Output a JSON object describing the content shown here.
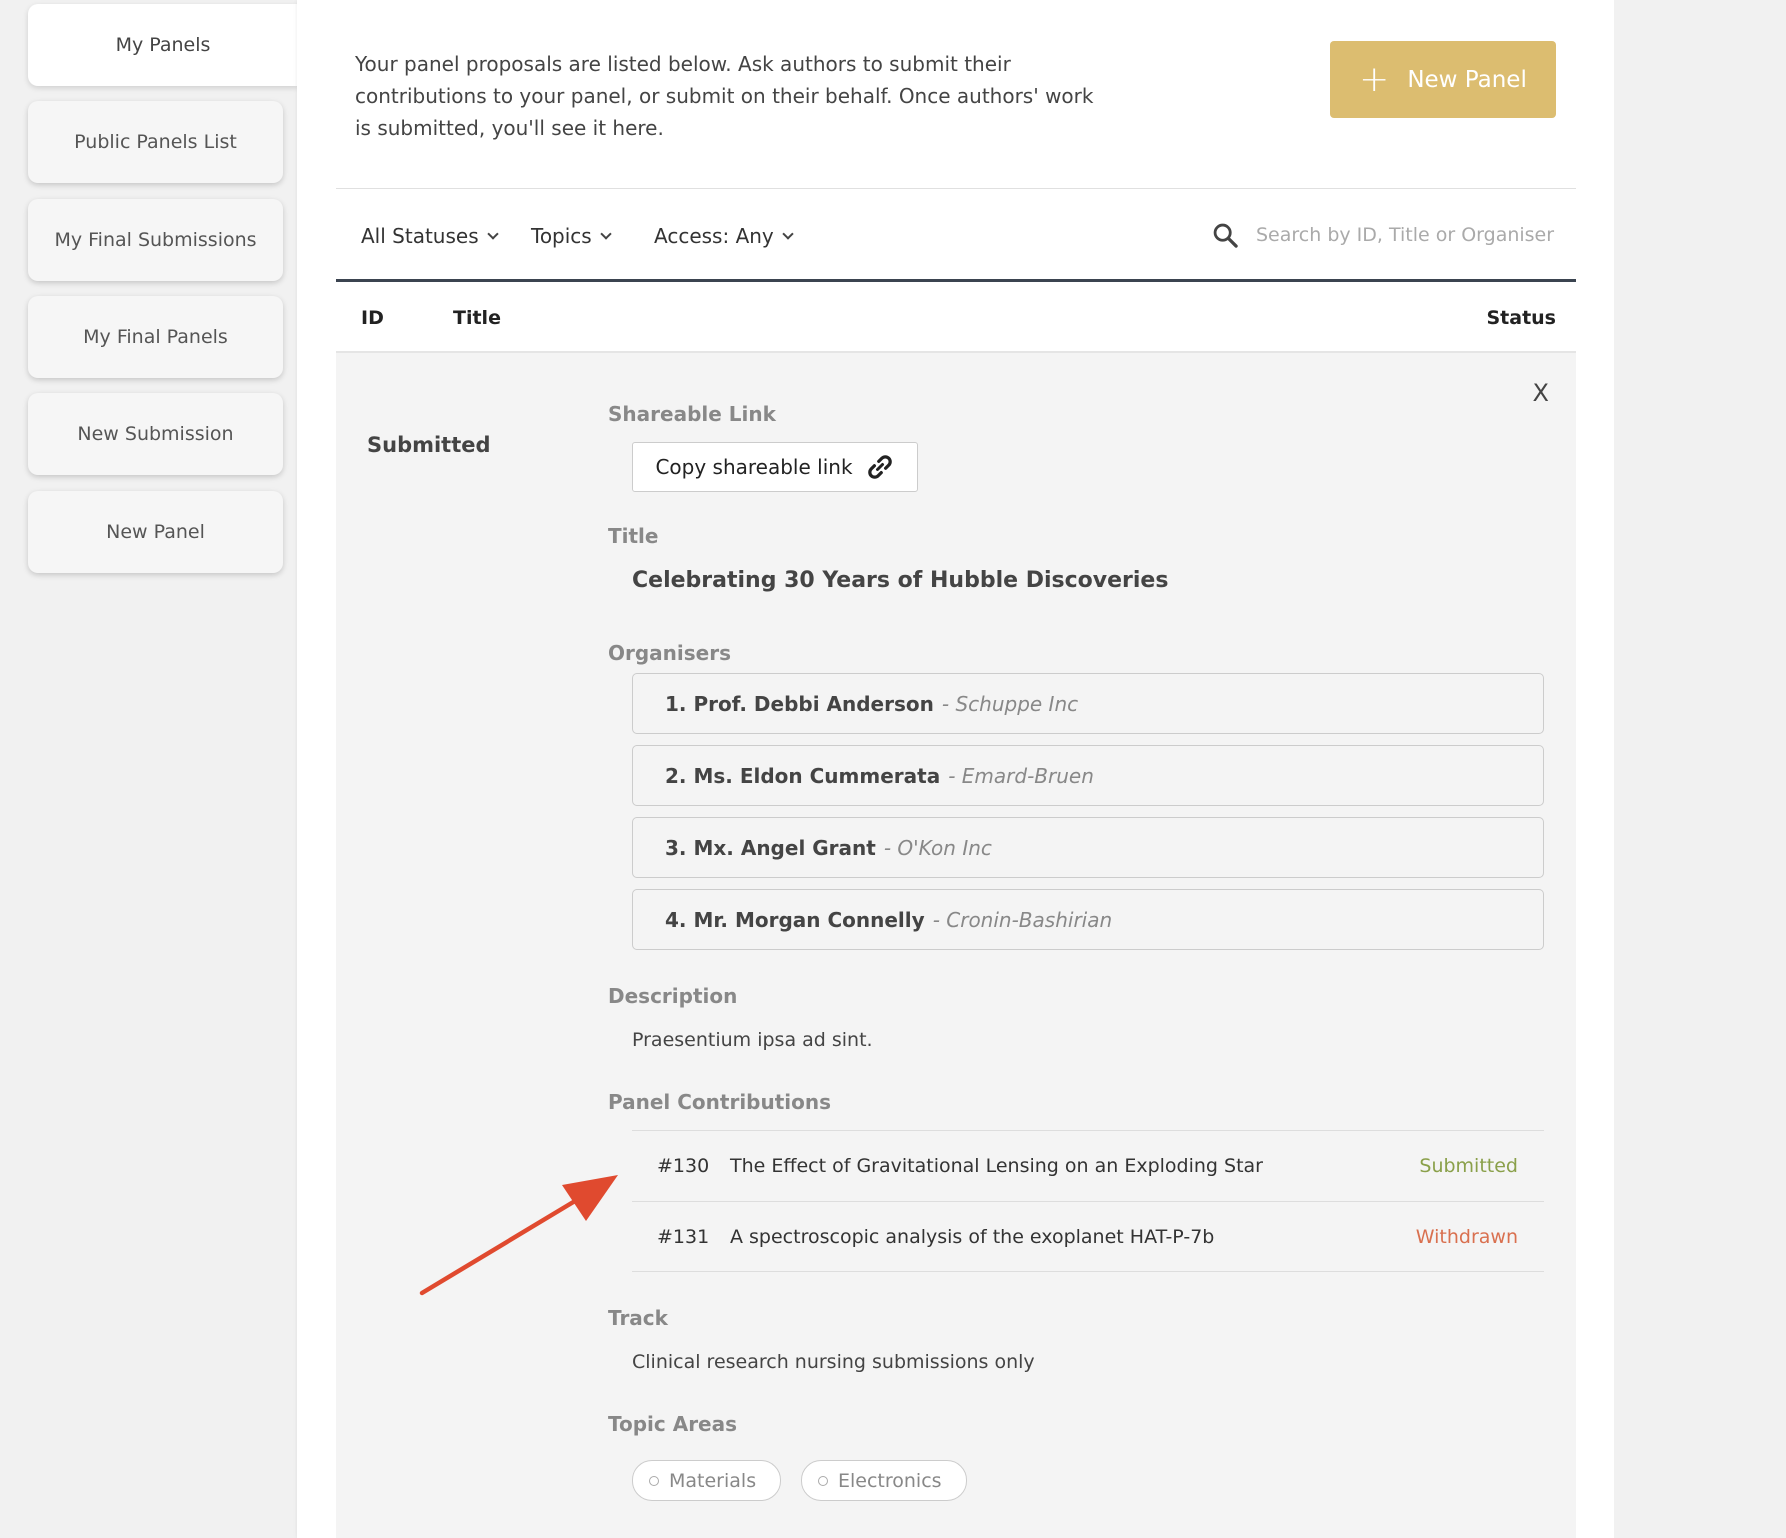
{
  "sidebar": {
    "items": [
      {
        "label": "My Panels",
        "active": true
      },
      {
        "label": "Public Panels List"
      },
      {
        "label": "My Final Submissions"
      },
      {
        "label": "My Final Panels"
      },
      {
        "label": "New Submission"
      },
      {
        "label": "New Panel"
      }
    ]
  },
  "header": {
    "intro": "Your panel proposals are listed below. Ask authors to submit their contributions to your panel, or submit on their behalf. Once authors' work is submitted, you'll see it here.",
    "new_panel_button": "New Panel"
  },
  "filters": {
    "statuses": "All Statuses",
    "topics": "Topics",
    "access": "Access: Any",
    "search_placeholder": "Search by ID, Title or Organiser"
  },
  "table": {
    "columns": {
      "id": "ID",
      "title": "Title",
      "status": "Status"
    }
  },
  "detail": {
    "close": "X",
    "status": "Submitted",
    "shareable_label": "Shareable Link",
    "copy_button": "Copy shareable link",
    "title_label": "Title",
    "title": "Celebrating 30 Years of Hubble Discoveries",
    "organisers_label": "Organisers",
    "organisers": [
      {
        "name": "1. Prof. Debbi Anderson",
        "affiliation": "- Schuppe Inc"
      },
      {
        "name": "2. Ms. Eldon Cummerata",
        "affiliation": "- Emard-Bruen"
      },
      {
        "name": "3. Mx. Angel Grant",
        "affiliation": "- O'Kon Inc"
      },
      {
        "name": "4. Mr. Morgan Connelly",
        "affiliation": "- Cronin-Bashirian"
      }
    ],
    "description_label": "Description",
    "description": "Praesentium ipsa ad sint.",
    "contributions_label": "Panel Contributions",
    "contributions": [
      {
        "id": "#130",
        "title": "The Effect of Gravitational Lensing on an Exploding Star",
        "status": "Submitted",
        "color": "#8aa04a"
      },
      {
        "id": "#131",
        "title": "A spectroscopic analysis of the exoplanet HAT-P-7b",
        "status": "Withdrawn",
        "color": "#d9704f"
      }
    ],
    "track_label": "Track",
    "track": "Clinical research nursing submissions only",
    "topics_label": "Topic Areas",
    "topics": [
      "Materials",
      "Electronics"
    ]
  },
  "colors": {
    "accent": "#dcbd70",
    "arrow": "#e04a2f",
    "submitted": "#8aa04a",
    "withdrawn": "#d9704f"
  }
}
